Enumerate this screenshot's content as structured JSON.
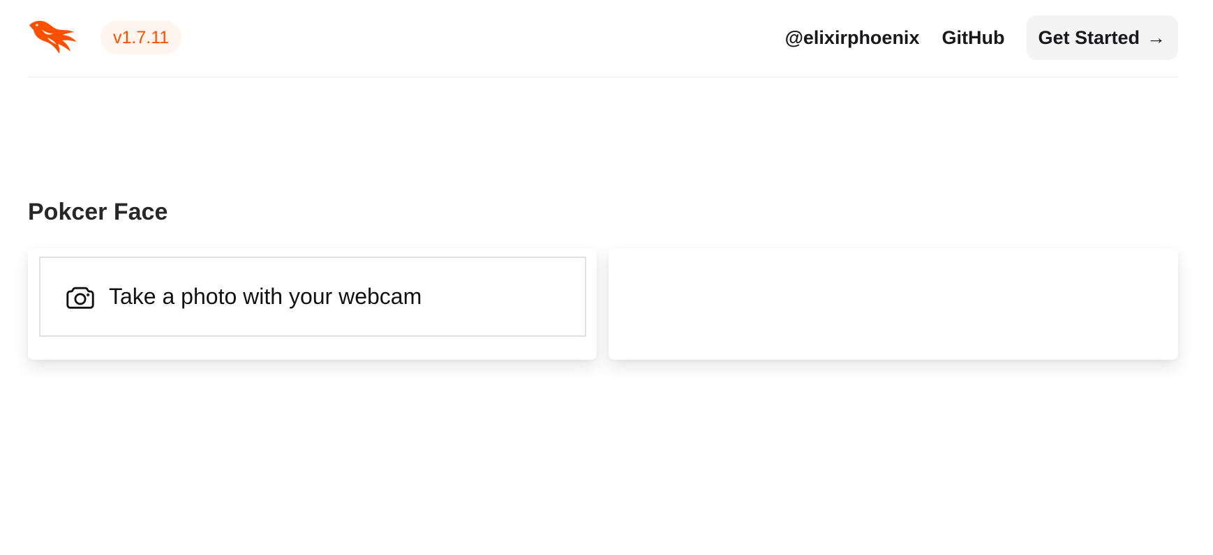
{
  "header": {
    "logo_icon": "phoenix-logo-icon",
    "version": "v1.7.11",
    "nav": {
      "twitter_label": "@elixirphoenix",
      "github_label": "GitHub",
      "cta_label": "Get Started",
      "cta_arrow": "→"
    }
  },
  "main": {
    "title": "Pokcer Face",
    "webcam_button": {
      "icon": "camera-icon",
      "label": "Take a photo with your webcam"
    }
  },
  "colors": {
    "accent": "#fd4f00",
    "badge_bg": "#fff4ee",
    "cta_bg": "#f4f4f5"
  }
}
